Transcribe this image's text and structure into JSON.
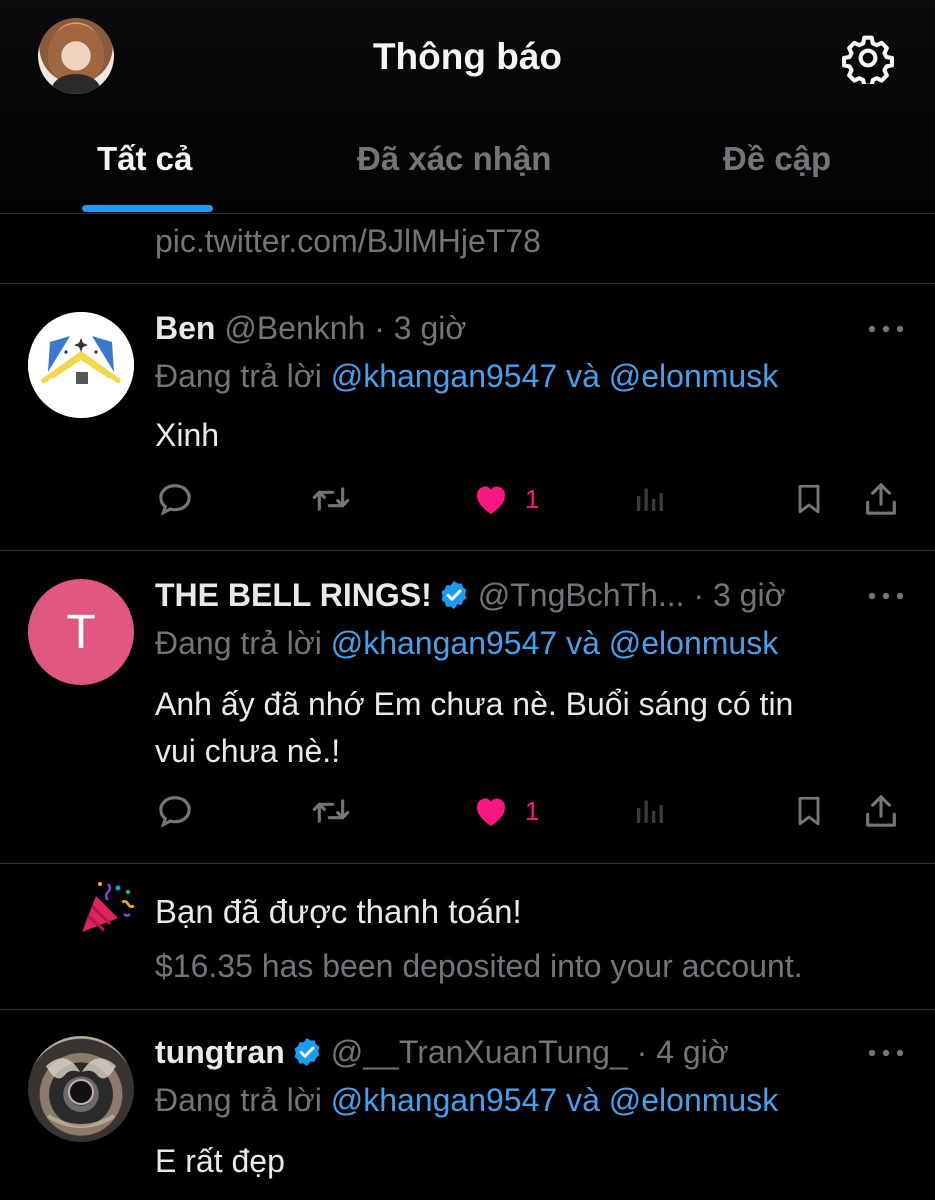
{
  "header": {
    "title": "Thông báo",
    "tabs": [
      {
        "label": "Tất cả",
        "active": true
      },
      {
        "label": "Đã xác nhận",
        "active": false
      },
      {
        "label": "Đề cập",
        "active": false
      }
    ]
  },
  "partial_tweet": {
    "link": "pic.twitter.com/BJlMHjeT78"
  },
  "tweets": [
    {
      "name": "Ben",
      "handle": "@Benknh",
      "time": "· 3 giờ",
      "reply_prefix": "Đang trả lời",
      "mention1": "@khangan9547",
      "reply_and": "và",
      "mention2": "@elonmusk",
      "text": "Xinh",
      "likes": "1"
    },
    {
      "name": "THE BELL RINGS!",
      "avatar_letter": "T",
      "handle": "@TngBchTh...",
      "time": "· 3 giờ",
      "reply_prefix": "Đang trả lời",
      "mention1": "@khangan9547",
      "reply_and": "và",
      "mention2": "@elonmusk",
      "text_line1": "Anh ấy đã nhớ Em chưa nè. Buổi sáng có tin",
      "text_line2": "vui chưa nè.!",
      "likes": "1"
    },
    {
      "name": "tungtran",
      "handle": "@__TranXuanTung_",
      "time": "· 4 giờ",
      "reply_prefix": "Đang trả lời",
      "mention1": "@khangan9547",
      "reply_and": "và",
      "mention2": "@elonmusk",
      "text": "E rất đẹp"
    }
  ],
  "payment": {
    "title": "Bạn đã được thanh toán!",
    "subtitle": "$16.35 has been deposited into your account."
  },
  "icons": [
    "gear-icon",
    "more-icon",
    "reply-icon",
    "retweet-icon",
    "heart-icon",
    "views-icon",
    "bookmark-icon",
    "share-icon",
    "verified-badge-icon",
    "party-popper-icon"
  ],
  "colors": {
    "accent": "#1d9bf0",
    "mention": "#4a9fe8",
    "like": "#f91880",
    "muted": "#71767b",
    "avatar_t": "#e0587f",
    "verified": "#1d9bf0"
  }
}
